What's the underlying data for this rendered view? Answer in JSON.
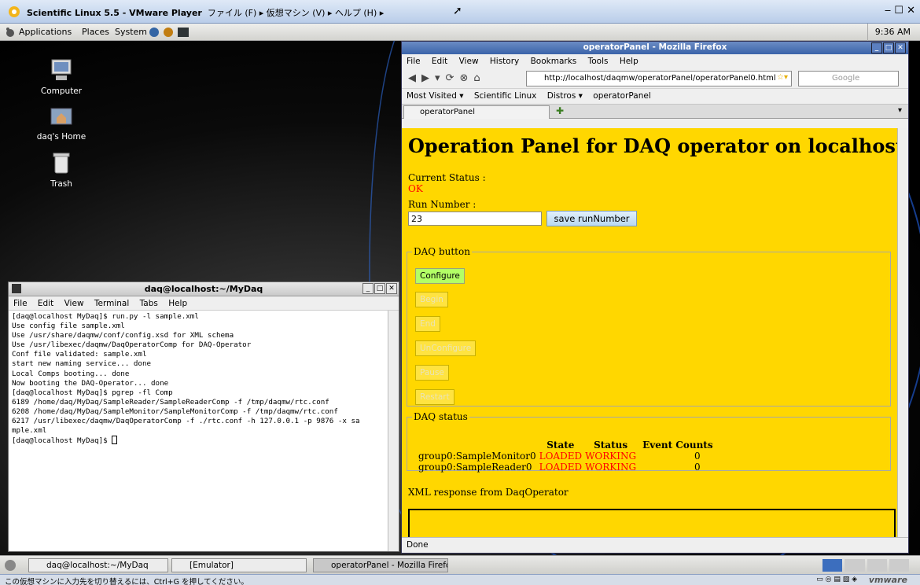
{
  "vmware": {
    "title": "Scientific Linux 5.5 - VMware Player",
    "menus": "ファイル (F) ▸ 仮想マシン (V) ▸ ヘルプ (H) ▸",
    "status_hint": "この仮想マシンに入力先を切り替えるには、Ctrl+G を押してください。",
    "logo": "vmware"
  },
  "panel": {
    "applications": "Applications",
    "places": "Places",
    "system": "System",
    "clock": "9:36 AM"
  },
  "desktop": {
    "icons": [
      {
        "label": "Computer",
        "icon": "computer-icon"
      },
      {
        "label": "daq's Home",
        "icon": "home-folder-icon"
      },
      {
        "label": "Trash",
        "icon": "trash-icon"
      }
    ]
  },
  "terminal": {
    "title": "daq@localhost:~/MyDaq",
    "menu": [
      "File",
      "Edit",
      "View",
      "Terminal",
      "Tabs",
      "Help"
    ],
    "lines": [
      "[daq@localhost MyDaq]$ run.py -l sample.xml",
      "Use config file sample.xml",
      "Use /usr/share/daqmw/conf/config.xsd for XML schema",
      "Use /usr/libexec/daqmw/DaqOperatorComp for DAQ-Operator",
      "Conf file validated: sample.xml",
      "start new naming service... done",
      "Local Comps booting... done",
      "Now booting the DAQ-Operator... done",
      "[daq@localhost MyDaq]$ pgrep -fl Comp",
      "6189 /home/daq/MyDaq/SampleReader/SampleReaderComp -f /tmp/daqmw/rtc.conf",
      "6208 /home/daq/MyDaq/SampleMonitor/SampleMonitorComp -f /tmp/daqmw/rtc.conf",
      "6217 /usr/libexec/daqmw/DaqOperatorComp -f ./rtc.conf -h 127.0.0.1 -p 9876 -x sa",
      "mple.xml"
    ],
    "prompt": "[daq@localhost MyDaq]$ "
  },
  "firefox": {
    "title": "operatorPanel - Mozilla Firefox",
    "menu": [
      "File",
      "Edit",
      "View",
      "History",
      "Bookmarks",
      "Tools",
      "Help"
    ],
    "url": "http://localhost/daqmw/operatorPanel/operatorPanel0.html",
    "search_placeholder": "Google",
    "bookmarks": [
      "Most Visited ▾",
      "Scientific Linux",
      "Distros ▾",
      "operatorPanel"
    ],
    "tab_label": "operatorPanel",
    "status": "Done"
  },
  "page": {
    "heading": "Operation Panel for DAQ operator on localhost",
    "current_status_label": "Current Status :",
    "current_status_value": "OK",
    "run_number_label": "Run Number :",
    "run_number_value": "23",
    "save_button": "save runNumber",
    "daq_button_legend": "DAQ button",
    "buttons": [
      "Configure",
      "Begin",
      "End",
      "UnConfigure",
      "Pause",
      "Restart"
    ],
    "daq_status_legend": "DAQ status",
    "status_headers": [
      "",
      "State",
      "Status",
      "Event Counts"
    ],
    "status_rows": [
      {
        "name": "group0:SampleMonitor0",
        "state": "LOADED",
        "status": "WORKING",
        "events": "0"
      },
      {
        "name": "group0:SampleReader0",
        "state": "LOADED",
        "status": "WORKING",
        "events": "0"
      }
    ],
    "xml_label": "XML response from DaqOperator"
  },
  "taskbar": {
    "items": [
      "daq@localhost:~/MyDaq",
      "[Emulator]",
      "operatorPanel - Mozilla Firefox"
    ]
  },
  "colors": {
    "page_bg": "#ffd700",
    "status_red": "#ff0000",
    "configure_green": "#b3ff66"
  }
}
